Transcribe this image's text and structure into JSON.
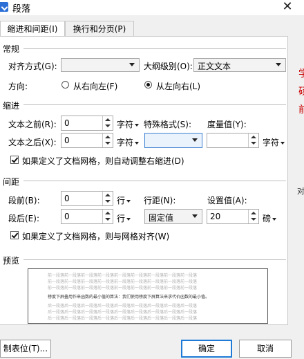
{
  "window": {
    "title": "段落"
  },
  "tabs": [
    {
      "label": "缩进和间距(I)"
    },
    {
      "label": "换行和分页(P)"
    }
  ],
  "general": {
    "heading": "常规",
    "alignment_label": "对齐方式(G):",
    "alignment_value": "",
    "outline_label": "大纲级别(O):",
    "outline_value": "正文文本",
    "direction_label": "方向:",
    "rtl_label": "从右向左(F)",
    "ltr_label": "从左向右(L)",
    "direction_selected": "ltr"
  },
  "indent": {
    "heading": "缩进",
    "before_label": "文本之前(R):",
    "before_value": "0",
    "before_unit": "字符",
    "after_label": "文本之后(X):",
    "after_value": "0",
    "after_unit": "字符",
    "special_label": "特殊格式(S):",
    "special_value": "",
    "measure_label": "度量值(Y):",
    "measure_value": "",
    "measure_unit": "字符",
    "auto_adjust_label": "如果定义了文档网格，则自动调整右缩进(D)",
    "auto_adjust_checked": true
  },
  "spacing": {
    "heading": "间距",
    "before_label": "段前(B):",
    "before_value": "0",
    "before_unit": "行",
    "after_label": "段后(E):",
    "after_value": "0",
    "after_unit": "行",
    "line_spacing_label": "行距(N):",
    "line_spacing_value": "固定值",
    "set_value_label": "设置值(A):",
    "set_value": "20",
    "set_value_unit": "磅",
    "snap_grid_label": "如果定义了文档网格，则与网格对齐(W)",
    "snap_grid_checked": true
  },
  "preview": {
    "heading": "预览",
    "prev_line": "前一段落前一段落前一段落前一段落前一段落前一段落前一段落前一段落前一段落",
    "main_line": "榜度下屏叠用作来函数的最小值的算法：我们使用榜度下屏算法来求代价函数的最小值。",
    "next_line": "后一段落后一段落后一段落后一段落后一段落后一段落后一段落后一段落后一段落"
  },
  "buttons": {
    "tabs_label": "制表位(T)...",
    "ok_label": "确定",
    "cancel_label": "取消"
  },
  "background_text": [
    "学",
    "砀",
    "前",
    "对"
  ]
}
